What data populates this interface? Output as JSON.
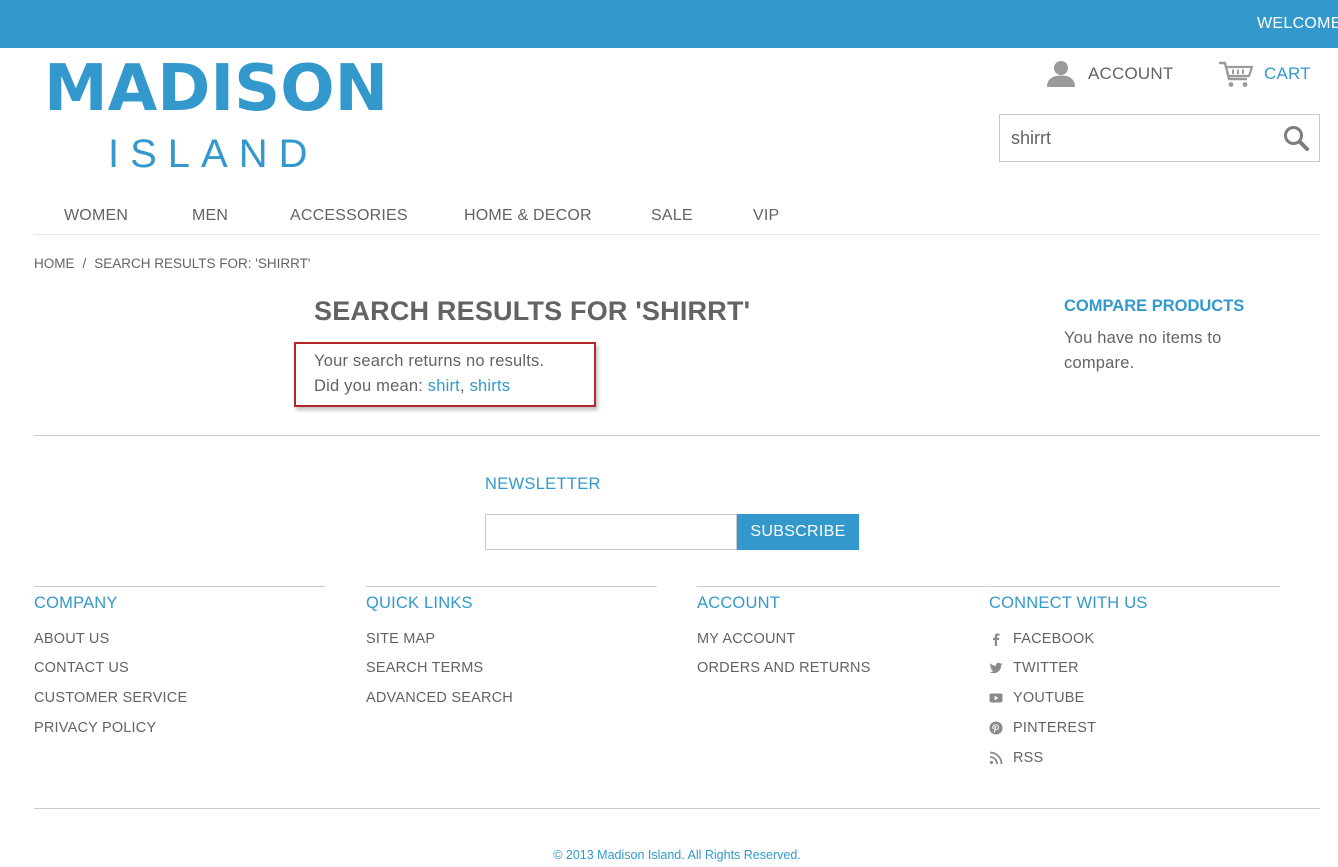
{
  "header": {
    "welcome": "WELCOME",
    "logo_top": "MADISON",
    "logo_bottom": "ISLAND",
    "account_label": "ACCOUNT",
    "cart_label": "CART",
    "search_value": "shirrt"
  },
  "nav": {
    "items": [
      "WOMEN",
      "MEN",
      "ACCESSORIES",
      "HOME & DECOR",
      "SALE",
      "VIP"
    ]
  },
  "breadcrumb": {
    "home": "HOME",
    "separator": "/",
    "current": "SEARCH RESULTS FOR: 'SHIRRT'"
  },
  "main": {
    "title": "SEARCH RESULTS FOR 'SHIRRT'",
    "no_results": "Your search returns no results.",
    "did_you_mean": "Did you mean:",
    "suggestions": [
      "shirt",
      "shirts"
    ],
    "comma": ","
  },
  "sidebar": {
    "compare_title": "COMPARE PRODUCTS",
    "compare_text": "You have no items to compare."
  },
  "newsletter": {
    "title": "NEWSLETTER",
    "input_value": "",
    "button": "SUBSCRIBE"
  },
  "footer": {
    "company": {
      "title": "COMPANY",
      "links": [
        "ABOUT US",
        "CONTACT US",
        "CUSTOMER SERVICE",
        "PRIVACY POLICY"
      ]
    },
    "quick_links": {
      "title": "QUICK LINKS",
      "links": [
        "SITE MAP",
        "SEARCH TERMS",
        "ADVANCED SEARCH"
      ]
    },
    "account": {
      "title": "ACCOUNT",
      "links": [
        "MY ACCOUNT",
        "ORDERS AND RETURNS"
      ]
    },
    "connect": {
      "title": "CONNECT WITH US",
      "links": [
        {
          "label": "FACEBOOK",
          "icon": "facebook-icon"
        },
        {
          "label": "TWITTER",
          "icon": "twitter-icon"
        },
        {
          "label": "YOUTUBE",
          "icon": "youtube-icon"
        },
        {
          "label": "PINTEREST",
          "icon": "pinterest-icon"
        },
        {
          "label": "RSS",
          "icon": "rss-icon"
        }
      ]
    },
    "copyright": "© 2013 Madison Island. All Rights Reserved."
  },
  "colors": {
    "brand": "#3399cc",
    "text": "#636363",
    "highlight_border": "#b5262a"
  }
}
